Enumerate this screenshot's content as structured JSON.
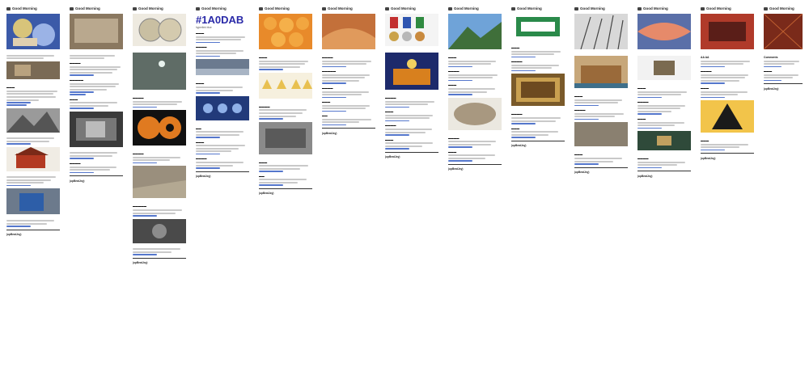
{
  "newsletter_name": "Good Morning",
  "footer_label": "(upBeatJoy)",
  "color_code_title": "#1A0DAB",
  "color_code_subtitle": "hyperlink blue",
  "labels": [
    "AA AA",
    "Comments"
  ],
  "colors": {
    "link": "#5577cc",
    "text_placeholder": "#c9c9c9",
    "accent_blue": "#2a2aa8"
  },
  "columns": [
    {
      "id": "c1"
    },
    {
      "id": "c2"
    },
    {
      "id": "c3"
    },
    {
      "id": "c4"
    },
    {
      "id": "c5"
    },
    {
      "id": "c6"
    },
    {
      "id": "c7"
    },
    {
      "id": "c8"
    },
    {
      "id": "c9"
    },
    {
      "id": "c10"
    },
    {
      "id": "c11"
    },
    {
      "id": "c12"
    },
    {
      "id": "c13"
    }
  ]
}
